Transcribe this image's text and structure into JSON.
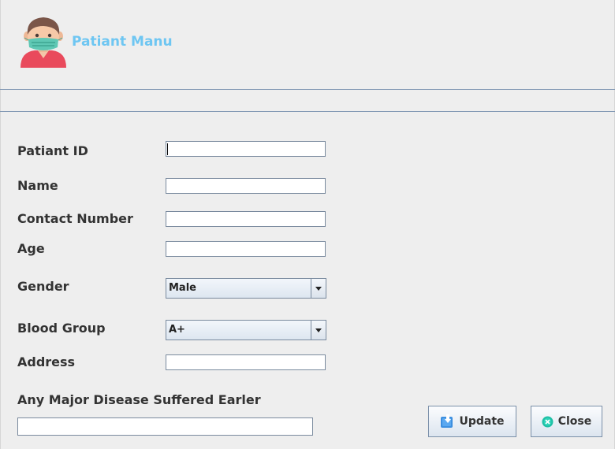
{
  "header": {
    "title": "Patiant Manu"
  },
  "form": {
    "patient_id": {
      "label": "Patiant ID",
      "value": ""
    },
    "name": {
      "label": "Name",
      "value": ""
    },
    "contact": {
      "label": "Contact Number",
      "value": ""
    },
    "age": {
      "label": "Age",
      "value": ""
    },
    "gender": {
      "label": "Gender",
      "value": "Male"
    },
    "blood_group": {
      "label": "Blood Group",
      "value": "A+"
    },
    "address": {
      "label": "Address",
      "value": ""
    },
    "disease": {
      "label": "Any Major Disease Suffered Earler",
      "value": ""
    }
  },
  "buttons": {
    "update": "Update",
    "close": "Close"
  },
  "icons": {
    "avatar": "patient-with-mask-icon",
    "update": "save-download-icon",
    "close": "close-circle-icon"
  },
  "colors": {
    "title": "#6ec6f2",
    "separator": "#7f96b2",
    "background": "#eeeeee"
  }
}
